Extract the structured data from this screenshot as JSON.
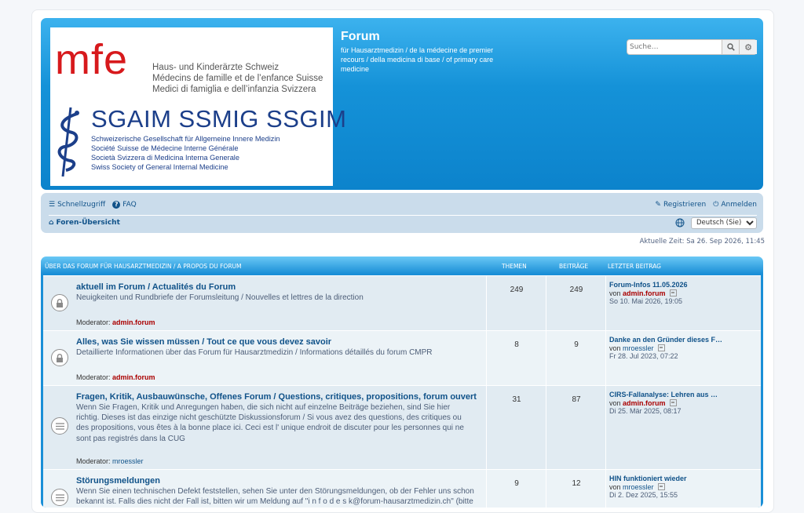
{
  "header": {
    "logo": {
      "mfe": "mfe",
      "mfe_lines": [
        "Haus- und Kinderärzte Schweiz",
        "Médecins de famille et de l’enfance Suisse",
        "Medici di famiglia e dell’infanzia Svizzera"
      ],
      "sgaim": "SGAIM SSMIG SSGIM",
      "sgaim_lines": [
        "Schweizerische Gesellschaft für Allgemeine Innere Medizin",
        "Société Suisse de Médecine Interne Générale",
        "Società Svizzera di Medicina Interna Generale",
        "Swiss Society of General Internal Medicine"
      ]
    },
    "site_title": "Forum",
    "site_description": "für Hausarztmedizin / de la médecine de premier recours / della medicina di base / of primary care medicine",
    "search_placeholder": "Suche…",
    "search_icon": "magnifier-icon",
    "advanced_search_icon": "gear-icon"
  },
  "navbar": {
    "quicklinks": "Schnellzugriff",
    "faq": "FAQ",
    "register": "Registrieren",
    "login": "Anmelden",
    "breadcrumb_home": "Foren-Übersicht",
    "language_selected": "Deutsch (Sie)"
  },
  "current_time": "Aktuelle Zeit: Sa 26. Sep 2026, 11:45",
  "forum_table": {
    "category": "Über das Forum für Hausarztmedizin / A propos du forum",
    "col_topics": "Themen",
    "col_posts": "Beiträge",
    "col_last": "Letzter Beitrag",
    "rows": [
      {
        "title": "aktuell im Forum / Actualités du Forum",
        "description": "Neuigkeiten und Rundbriefe der Forumsleitung / Nouvelles et lettres de la direction",
        "moderator_label": "Moderator:",
        "moderator": "admin.forum",
        "topics": "249",
        "posts": "249",
        "last_title": "Forum-Infos 11.05.2026",
        "last_by_label": "von",
        "last_by": "admin.forum",
        "last_date": "So 10. Mai 2026, 19:05",
        "icon": "lock-icon"
      },
      {
        "title": "Alles, was Sie wissen müssen / Tout ce que vous devez savoir",
        "description": "Detaillierte Informationen über das Forum für Hausarztmedizin / Informations détaillés du forum CMPR",
        "moderator_label": "Moderator:",
        "moderator": "admin.forum",
        "topics": "8",
        "posts": "9",
        "last_title": "Danke an den Gründer dieses F…",
        "last_by_label": "von",
        "last_by": "mroessler",
        "last_date": "Fr 28. Jul 2023, 07:22",
        "icon": "lock-icon"
      },
      {
        "title": "Fragen, Kritik, Ausbauwünsche, Offenes Forum / Questions, critiques, propositions, forum ouvert",
        "description": "Wenn Sie Fragen, Kritik und Anregungen haben, die sich nicht auf einzelne Beiträge beziehen, sind Sie hier richtig. Dieses ist das einzige nicht geschützte Diskussionsforum / Si vous avez des questions, des critiques ou des propositions, vous êtes à la bonne place ici. Ceci est l' unique endroit de discuter pour les personnes qui ne sont pas registrés dans la CUG",
        "moderator_label": "Moderator:",
        "moderator": "mroessler",
        "topics": "31",
        "posts": "87",
        "last_title": "CIRS-Fallanalyse: Lehren aus …",
        "last_by_label": "von",
        "last_by": "admin.forum",
        "last_date": "Di 25. Mär 2025, 08:17",
        "icon": "forum-read-icon"
      },
      {
        "title": "Störungsmeldungen",
        "description": "Wenn Sie einen technischen Defekt feststellen, sehen Sie unter den Störungsmeldungen, ob der Fehler uns schon bekannt ist. Falls dies nicht der Fall ist, bitten wir um Meldung auf \"i n f o d e s k@forum-hausarztmedizin.ch\" (bitte",
        "topics": "9",
        "posts": "12",
        "last_title": "HIN funktioniert wieder",
        "last_by_label": "von",
        "last_by": "mroessler",
        "last_date": "Di 2. Dez 2025, 15:55",
        "icon": "forum-read-icon"
      }
    ]
  }
}
